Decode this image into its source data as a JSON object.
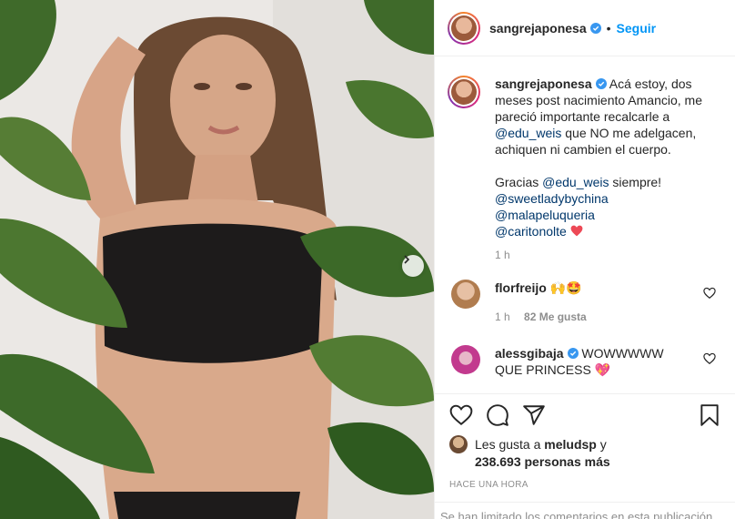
{
  "post": {
    "username": "sangrejaponesa",
    "separator": "•",
    "follow_label": "Seguir"
  },
  "caption": {
    "username": "sangrejaponesa",
    "line1": "Acá estoy, dos meses post nacimiento Amancio, me pareció importante recalcarle a",
    "mention1": "@edu_weis",
    "line2": "que NO me adelgacen, achiquen ni cambien el cuerpo.",
    "thanks": "Gracias",
    "mention2": "@edu_weis",
    "thanks_end": "siempre!",
    "tag1": "@sweetladybychina",
    "tag2": "@malapeluqueria",
    "tag3": "@caritonolte",
    "time": "1 h"
  },
  "comments": [
    {
      "username": "florfreijo",
      "text": "🙌🤩",
      "time": "1 h",
      "likes": "82 Me gusta"
    },
    {
      "username": "alessgibaja",
      "text": "WOWWWWW QUE PRINCESS 💖"
    }
  ],
  "likes": {
    "prefix": "Les gusta a",
    "user": "meludsp",
    "joiner": "y",
    "count": "238.693 personas más"
  },
  "posted_ago": "HACE UNA HORA",
  "comments_limited": "Se han limitado los comentarios en esta publicación.",
  "icons": {
    "like": "heart-icon",
    "comment": "comment-icon",
    "share": "paper-plane-icon",
    "save": "bookmark-icon",
    "verified": "verified-badge-icon",
    "next": "chevron-right-icon"
  },
  "colors": {
    "link_blue": "#0095f6",
    "mention": "#00376b",
    "muted": "#8e8e8e",
    "heart_red": "#ed4956"
  }
}
